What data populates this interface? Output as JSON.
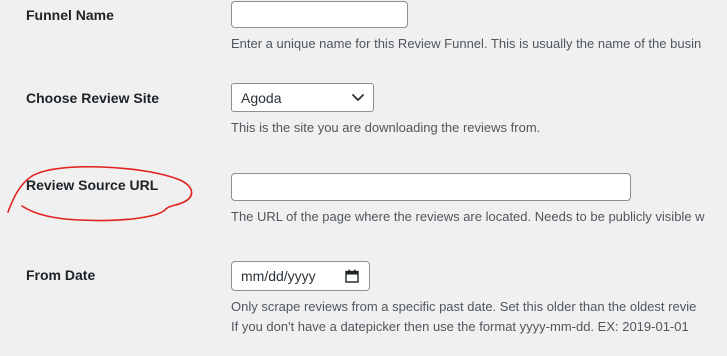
{
  "form": {
    "funnel_name": {
      "label": "Funnel Name",
      "value": "",
      "description": "Enter a unique name for this Review Funnel. This is usually the name of the busin"
    },
    "review_site": {
      "label": "Choose Review Site",
      "selected": "Agoda",
      "description": "This is the site you are downloading the reviews from."
    },
    "review_source_url": {
      "label": "Review Source URL",
      "value": "",
      "description": "The URL of the page where the reviews are located. Needs to be publicly visible w"
    },
    "from_date": {
      "label": "From Date",
      "placeholder": "mm/dd/yyyy",
      "description_line1": "Only scrape reviews from a specific past date. Set this older than the oldest revie",
      "description_line2": "If you don't have a datepicker then use the format yyyy-mm-dd. EX: 2019-01-01"
    }
  },
  "colors": {
    "annotation": "#e0201c",
    "input_border": "#8c8f94",
    "page_background": "#f0f0f1"
  },
  "icons": {
    "select_arrow": "chevron-down-icon",
    "date_picker": "calendar-icon"
  }
}
